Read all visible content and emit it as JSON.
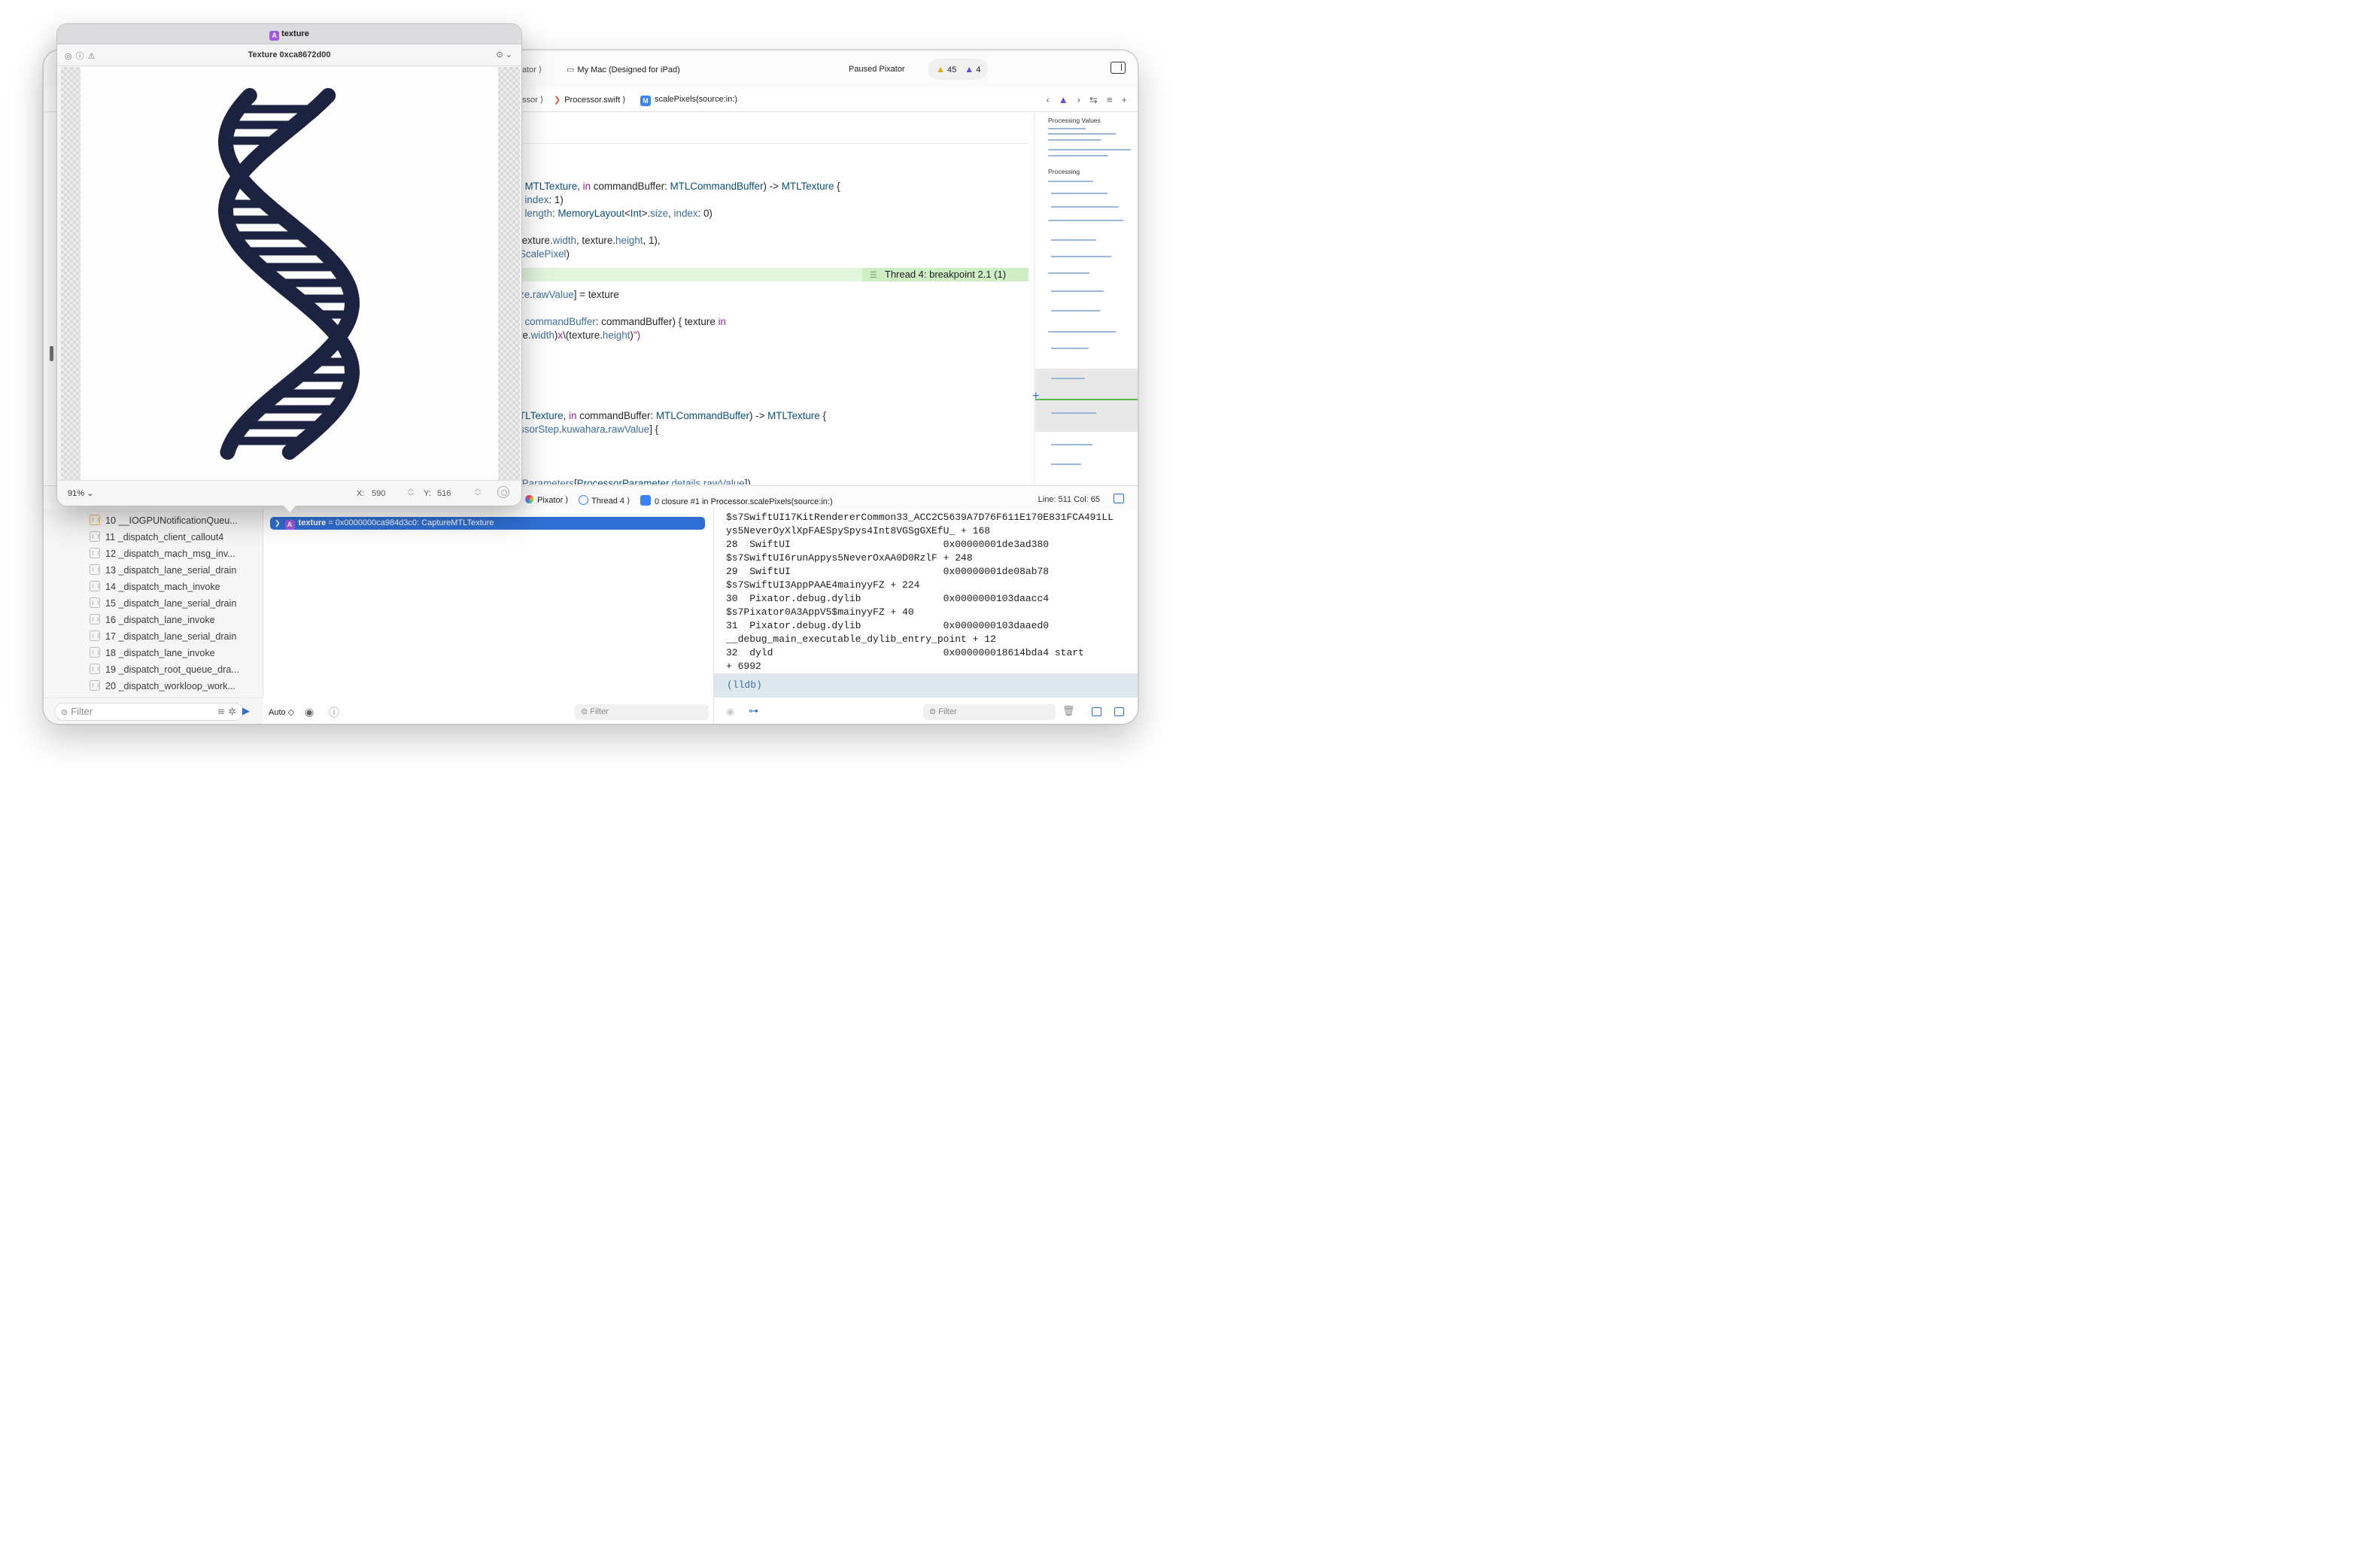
{
  "toolbar": {
    "scheme_tail": "ator",
    "device": "My Mac (Designed for iPad)",
    "status": "Paused Pixator",
    "warnings": "45",
    "errors": "4"
  },
  "jumpbar": {
    "group_tail": "ssor",
    "file": "Processor.swift",
    "symbol_badge": "M",
    "symbol": "scalePixels(source:in:)"
  },
  "editor": {
    "breakpoint_label": "Thread 4: breakpoint 2.1 (1)"
  },
  "minimap": {
    "mark_1": "Processing Values",
    "mark_2": "Processing"
  },
  "debug_bar": {
    "app": "Pixator",
    "thread": "Thread 4",
    "frame": "0 closure #1 in Processor.scalePixels(source:in:)",
    "line_col": "Line: 511  Col: 65"
  },
  "variables": {
    "row_name": "texture",
    "row_value": " = 0x0000000ca984d3c0: CaptureMTLTexture",
    "auto_label": "Auto ◇",
    "filter_placeholder": "Filter"
  },
  "console": {
    "lines": [
      "$s7SwiftUI17KitRendererCommon33_ACC2C5639A7D76F611E170E831FCA491LL",
      "ys5NeverOyXlXpFAESpySpys4Int8VGSgGXEfU_ + 168",
      "28  SwiftUI                          0x00000001de3ad380",
      "$s7SwiftUI6runAppys5NeverOxAA0D0RzlF + 248",
      "29  SwiftUI                          0x00000001de08ab78",
      "$s7SwiftUI3AppPAAE4mainyyFZ + 224",
      "30  Pixator.debug.dylib              0x0000000103daacc4",
      "$s7Pixator0A3AppV5$mainyyFZ + 40",
      "31  Pixator.debug.dylib              0x0000000103daaed0",
      "__debug_main_executable_dylib_entry_point + 12",
      "32  dyld                             0x000000018614bda4 start",
      "+ 6992"
    ],
    "prompt": "(lldb)",
    "filter_placeholder": "Filter"
  },
  "navigator": {
    "items": [
      "10 __IOGPUNotificationQueu...",
      "11 _dispatch_client_callout4",
      "12 _dispatch_mach_msg_inv...",
      "13 _dispatch_lane_serial_drain",
      "14 _dispatch_mach_invoke",
      "15 _dispatch_lane_serial_drain",
      "16 _dispatch_lane_invoke",
      "17 _dispatch_lane_serial_drain",
      "18 _dispatch_lane_invoke",
      "19 _dispatch_root_queue_dra...",
      "20 _dispatch_workloop_work..."
    ],
    "filter_placeholder": "Filter"
  },
  "texture_window": {
    "badge": "A",
    "title": "texture",
    "header_title": "Texture 0xca8672d00",
    "zoom": "91%",
    "x_label": "X:",
    "x_value": "590",
    "y_label": "Y:",
    "y_value": "516",
    "image_color": "#1c2341"
  },
  "colors": {
    "accent": "#2f6fd3",
    "breakpoint_line": "#e2f5dd",
    "warning": "#e6a700",
    "error": "#5b4fd8"
  }
}
